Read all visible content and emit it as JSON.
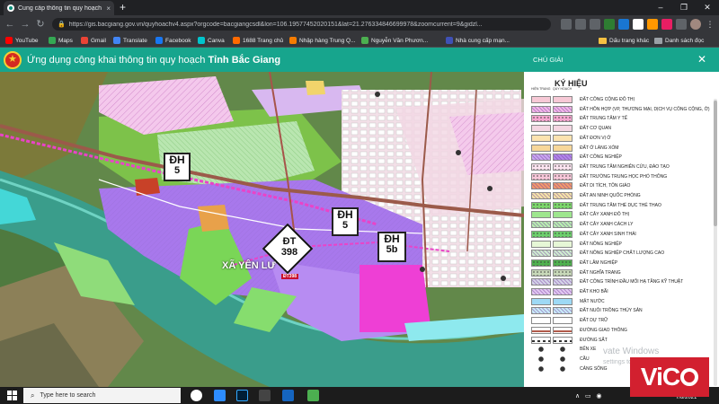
{
  "browser": {
    "tab_title": "Cung cấp thông tin quy hoạch V",
    "tab_close": "×",
    "new_tab": "+",
    "url": "https://gis.bacgiang.gov.vn/quyhoachv4.aspx?orgcode=bacgiangcsdl&lon=106.19577452020151&lat=21.276334846699978&zoomcurrent=9&gidzl...",
    "window_controls": [
      "–",
      "❐",
      "✕"
    ]
  },
  "bookmarks": {
    "items": [
      {
        "label": "YouTube",
        "color": "#ff0000"
      },
      {
        "label": "Maps",
        "color": "#34a853"
      },
      {
        "label": "Gmail",
        "color": "#ea4335"
      },
      {
        "label": "Translate",
        "color": "#4285f4"
      },
      {
        "label": "Facebook",
        "color": "#1877f2"
      },
      {
        "label": "Canva",
        "color": "#00c4cc"
      },
      {
        "label": "1688 Trang chủ",
        "color": "#ff6a00"
      },
      {
        "label": "Nhập hàng Trung Q...",
        "color": "#f57c00"
      },
      {
        "label": "Nguyễn Văn Phươn...",
        "color": "#4caf50"
      },
      {
        "label": "Nhà cung cấp mạn...",
        "color": "#3f51b5"
      }
    ],
    "right_items": [
      "Dấu trang khác",
      "Danh sách đọc"
    ]
  },
  "site": {
    "title_prefix": "Ứng dụng công khai thông tin quy hoạch ",
    "title_province": "Tỉnh Bắc Giang"
  },
  "map": {
    "shields": [
      {
        "line1": "ĐH",
        "line2": "5"
      },
      {
        "line1": "ĐH",
        "line2": "5"
      },
      {
        "line1": "ĐH",
        "line2": "5b"
      }
    ],
    "diamond": {
      "line1": "ĐT",
      "line2": "398"
    },
    "area_name": "XÃ YÊN LƯ",
    "road_label": "ĐT398"
  },
  "legend": {
    "header": "CHÚ GIẢI",
    "close": "✕",
    "title": "KÝ HIỆU",
    "col_left": "HIỆN TRẠNG",
    "col_right": "QUY HOẠCH",
    "items": [
      {
        "label": "ĐẤT CÔNG CỘNG ĐÔ THỊ",
        "left": "#f7c9d6",
        "right": "#f7c9d6",
        "pattern": "none"
      },
      {
        "label": "ĐẤT HỖN HỢP (VP, THƯƠNG MẠI, DỊCH VỤ CÔNG CỘNG, Ở)",
        "left": "#f2b8e8",
        "right": "#f2b8e8",
        "pattern": "hatch"
      },
      {
        "label": "ĐẤT TRUNG TÂM Y TẾ",
        "left": "#f5a6d0",
        "right": "#f5a6d0",
        "pattern": "dot"
      },
      {
        "label": "ĐẤT CƠ QUAN",
        "left": "#f4d6e2",
        "right": "#f4d6e2",
        "pattern": "none"
      },
      {
        "label": "ĐẤT ĐƠN VỊ Ở",
        "left": "#fce3b0",
        "right": "#fce3b0",
        "pattern": "none"
      },
      {
        "label": "ĐẤT Ở LÀNG XÓM",
        "left": "#f7d79a",
        "right": "#f7d79a",
        "pattern": "none"
      },
      {
        "label": "ĐẤT CÔNG NGHIỆP",
        "left": "#c9a8f0",
        "right": "#b187ea",
        "pattern": "hatch"
      },
      {
        "label": "ĐẤT TRUNG TÂM NGHIÊN CỨU, ĐÀO TẠO",
        "left": "#fbe3ef",
        "right": "#fbe3ef",
        "pattern": "dot"
      },
      {
        "label": "ĐẤT TRƯỜNG TRUNG HỌC PHỔ THÔNG",
        "left": "#f7c7d9",
        "right": "#f7c7d9",
        "pattern": "dot"
      },
      {
        "label": "ĐẤT DI TÍCH, TÔN GIÁO",
        "left": "#f29b6b",
        "right": "#f29b6b",
        "pattern": "hatch"
      },
      {
        "label": "ĐẤT AN NINH QUỐC PHÒNG",
        "left": "#f5e6a8",
        "right": "#f5e6a8",
        "pattern": "hatch"
      },
      {
        "label": "ĐẤT TRUNG TÂM THỂ DỤC THỂ THAO",
        "left": "#7cd66b",
        "right": "#7cd66b",
        "pattern": "dot"
      },
      {
        "label": "ĐẤT CÂY XANH ĐÔ THỊ",
        "left": "#9ee68e",
        "right": "#9ee68e",
        "pattern": "none"
      },
      {
        "label": "ĐẤT CÂY XANH CÁCH LY",
        "left": "#b8f0b0",
        "right": "#b8f0b0",
        "pattern": "hatch"
      },
      {
        "label": "ĐẤT CÂY XANH SINH THÁI",
        "left": "#6ccf6c",
        "right": "#6ccf6c",
        "pattern": "dot"
      },
      {
        "label": "ĐẤT NÔNG NGHIỆP",
        "left": "#e6f7d6",
        "right": "#e6f7d6",
        "pattern": "none"
      },
      {
        "label": "ĐẤT NÔNG NGHIỆP CHẤT LƯỢNG CAO",
        "left": "#cfeecf",
        "right": "#cfeecf",
        "pattern": "hatch"
      },
      {
        "label": "ĐẤT LÂM NGHIỆP",
        "left": "#4fb24f",
        "right": "#4fb24f",
        "pattern": "dot"
      },
      {
        "label": "ĐẤT NGHĨA TRANG",
        "left": "#c7d8b8",
        "right": "#c7d8b8",
        "pattern": "dot"
      },
      {
        "label": "ĐẤT CÔNG TRÌNH ĐẦU MỐI HẠ TẦNG KỸ THUẬT",
        "left": "#d5d5e8",
        "right": "#d5d5e8",
        "pattern": "hatch"
      },
      {
        "label": "ĐẤT KHO BÃI",
        "left": "#e2c9f2",
        "right": "#e2c9f2",
        "pattern": "hatch"
      },
      {
        "label": "MẶT NƯỚC",
        "left": "#9ed9f5",
        "right": "#9ed9f5",
        "pattern": "none"
      },
      {
        "label": "ĐẤT NUÔI TRỒNG THỦY SẢN",
        "left": "#c8ecf8",
        "right": "#c8ecf8",
        "pattern": "hatch"
      },
      {
        "label": "ĐẤT DỰ TRỮ",
        "left": "#ffffff",
        "right": "#ffffff",
        "pattern": "none"
      },
      {
        "label": "ĐƯỜNG GIAO THÔNG",
        "left": "#ffffff",
        "right": "#ffffff",
        "pattern": "road"
      },
      {
        "label": "ĐƯỜNG SẮT",
        "left": "#ffffff",
        "right": "#ffffff",
        "pattern": "rail"
      },
      {
        "label": "BẾN XE",
        "left": "#ffffff",
        "right": "#ffffff",
        "pattern": "bus"
      },
      {
        "label": "CẦU",
        "left": "#ffffff",
        "right": "#ffffff",
        "pattern": "bridge"
      },
      {
        "label": "CẢNG SÔNG",
        "left": "#ffffff",
        "right": "#ffffff",
        "pattern": "port"
      }
    ],
    "watermark_line1": "vate Windows",
    "watermark_line2": "settings to act"
  },
  "taskbar": {
    "search_placeholder": "Type here to search",
    "clock_date": "7/8/2021"
  },
  "brand": {
    "text": "Vi",
    "text2": "O",
    "color": "#d2202f"
  }
}
